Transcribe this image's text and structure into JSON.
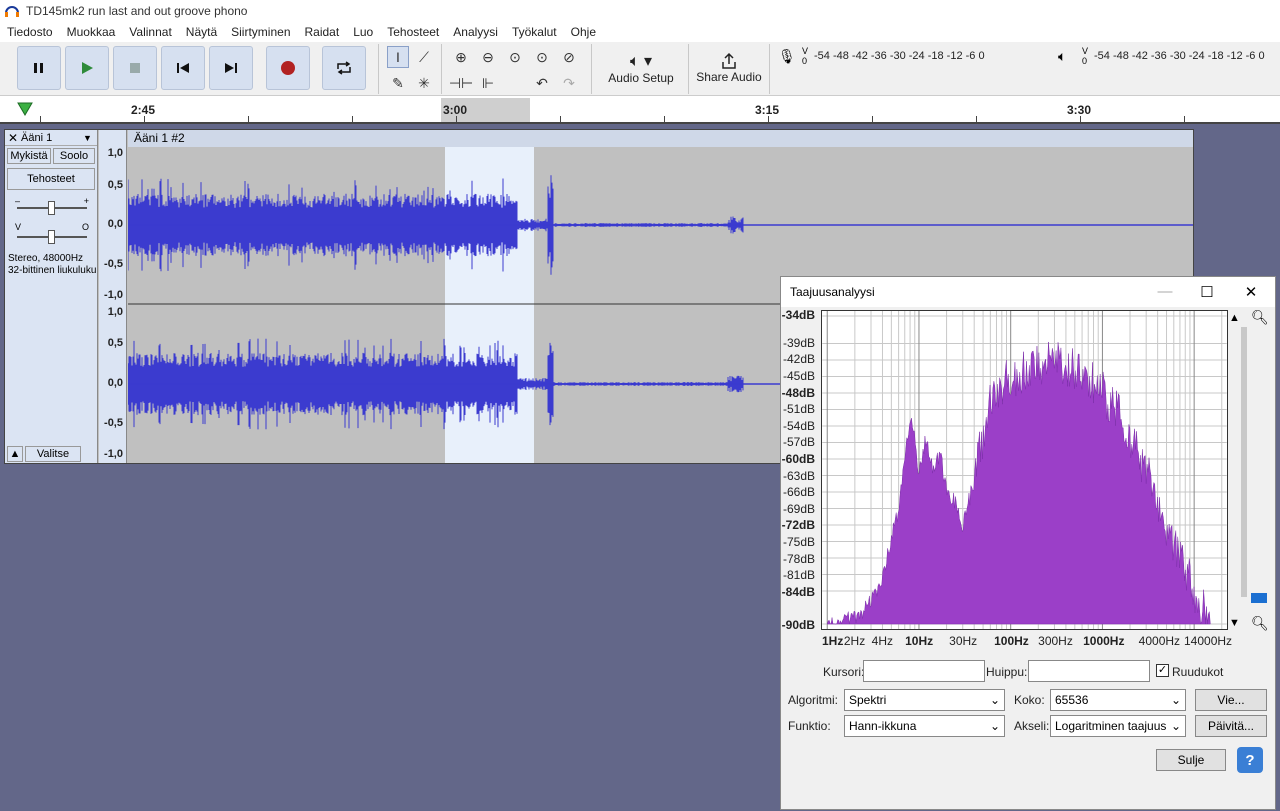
{
  "window": {
    "title": "TD145mk2 run last and out groove phono"
  },
  "menu": [
    "Tiedosto",
    "Muokkaa",
    "Valinnat",
    "Näytä",
    "Siirtyminen",
    "Raidat",
    "Luo",
    "Tehosteet",
    "Analyysi",
    "Työkalut",
    "Ohje"
  ],
  "toolbar": {
    "audio_setup": "Audio Setup",
    "share_audio": "Share Audio",
    "record_meter_scale": "-54 -48 -42 -36 -30 -24 -18 -12 -6 0",
    "play_meter_scale": "-54 -48 -42 -36 -30 -24 -18 -12 -6 0"
  },
  "ruler": {
    "labels": [
      "2:45",
      "3:00",
      "3:15",
      "3:30"
    ]
  },
  "track": {
    "name": "Ääni 1",
    "mute": "Mykistä",
    "solo": "Soolo",
    "effects": "Tehosteet",
    "info_line1": "Stereo, 48000Hz",
    "info_line2": "32-bittinen liukuluku",
    "select": "Valitse",
    "clip_name": "Ääni 1 #2",
    "scale_top": [
      "1,0",
      "0,5",
      "0,0",
      "-0,5",
      "-1,0"
    ],
    "scale_bottom": [
      "1,0",
      "0,5",
      "0,0",
      "-0,5",
      "-1,0"
    ]
  },
  "dialog": {
    "title": "Taajuusanalyysi",
    "y_labels": [
      "-34dB",
      "-39dB",
      "-42dB",
      "-45dB",
      "-48dB",
      "-51dB",
      "-54dB",
      "-57dB",
      "-60dB",
      "-63dB",
      "-66dB",
      "-69dB",
      "-72dB",
      "-75dB",
      "-78dB",
      "-81dB",
      "-84dB",
      "-90dB"
    ],
    "x_labels": [
      "1Hz",
      "2Hz",
      "4Hz",
      "10Hz",
      "30Hz",
      "100Hz",
      "300Hz",
      "1000Hz",
      "4000Hz",
      "14000Hz"
    ],
    "cursor_label": "Kursori:",
    "peak_label": "Huippu:",
    "grid_label": "Ruudukot",
    "algorithm_label": "Algoritmi:",
    "algorithm_value": "Spektri",
    "size_label": "Koko:",
    "size_value": "65536",
    "export_button": "Vie...",
    "function_label": "Funktio:",
    "function_value": "Hann-ikkuna",
    "axis_label": "Akseli:",
    "axis_value": "Logaritminen taajuus",
    "refresh_button": "Päivitä...",
    "close_button": "Sulje",
    "help_button": "?"
  },
  "colors": {
    "waveform": "#3b3bcf",
    "spectrum": "#9b3fc8",
    "selection": "#e8f0fb",
    "background": "#636789"
  }
}
